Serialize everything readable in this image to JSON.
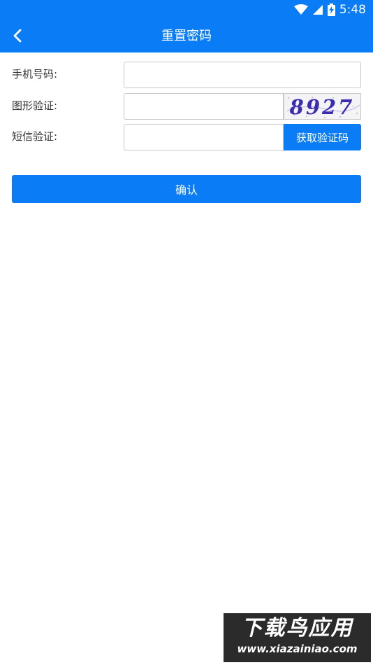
{
  "status_bar": {
    "time": "5:48",
    "icons": [
      "wifi-icon",
      "signal-icon",
      "battery-charging-icon"
    ]
  },
  "header": {
    "title": "重置密码",
    "back_icon": "chevron-left-icon"
  },
  "form": {
    "phone_label": "手机号码:",
    "phone_value": "",
    "captcha_label": "图形验证:",
    "captcha_value": "",
    "captcha_image_text": "8927",
    "sms_label": "短信验证:",
    "sms_value": "",
    "sms_button": "获取验证码"
  },
  "confirm_button": "确认",
  "watermark": {
    "title": "下载鸟应用",
    "url": "www.xiazainiao.com"
  },
  "colors": {
    "primary": "#0a7cf5",
    "background": "#ffffff",
    "text": "#333333"
  }
}
